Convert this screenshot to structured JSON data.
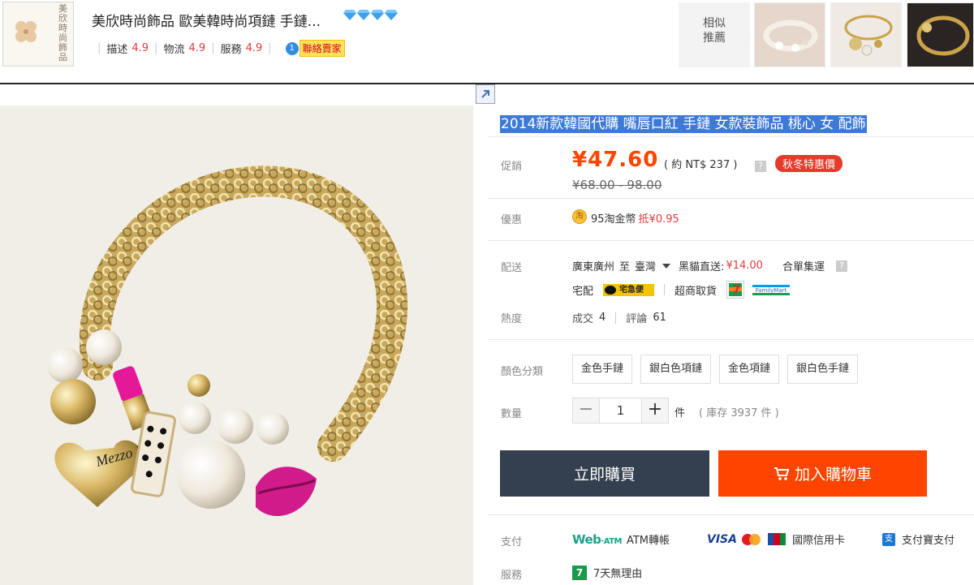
{
  "shop": {
    "logo_vertical_text": "美欣時尚飾品",
    "name": "美欣時尚飾品 歐美韓時尚項鏈 手鏈...",
    "ratings": [
      {
        "label": "描述",
        "value": "4.9"
      },
      {
        "label": "物流",
        "value": "4.9"
      },
      {
        "label": "服務",
        "value": "4.9"
      }
    ],
    "contact_label": "聯絡賣家",
    "diamond_count": 4
  },
  "similar": {
    "label_line1": "相似",
    "label_line2": "推薦"
  },
  "product": {
    "title": "2014新款韓國代購 嘴唇口紅 手鏈 女款裝飾品 桃心 女 配飾",
    "image_alt_text": "Mezzo Piano"
  },
  "price": {
    "label": "促銷",
    "current": "¥47.60",
    "ntd": "( 約 NT$ 237 )",
    "help": "?",
    "badge": "秋冬特惠價",
    "original": "¥68.00 - 98.00"
  },
  "discount": {
    "label": "優惠",
    "coin_icon": "淘",
    "text": "95淘金幣",
    "deduct": "抵¥0.95"
  },
  "shipping": {
    "label": "配送",
    "from": "廣東廣州",
    "to_word": "至",
    "destination": "臺灣",
    "direct_label": "黑貓直送:",
    "direct_fee": "¥14.00",
    "consolidate": "合單集運",
    "help": "?",
    "home_delivery": "宅配",
    "black_cat_text": "宅急便",
    "store_pickup": "超商取貨",
    "familymart_text": "FamilyMart"
  },
  "heat": {
    "label": "熱度",
    "sold_label": "成交",
    "sold": "4",
    "review_label": "評論",
    "reviews": "61"
  },
  "colors": {
    "label": "顏色分類",
    "options": [
      "金色手鏈",
      "銀白色項鏈",
      "金色項鏈",
      "銀白色手鏈"
    ]
  },
  "quantity": {
    "label": "數量",
    "minus": "−",
    "value": "1",
    "plus": "+",
    "unit": "件",
    "stock": "( 庫存 3937 件 )"
  },
  "actions": {
    "buy_now": "立即購買",
    "add_to_cart": "加入購物車"
  },
  "payment": {
    "label": "支付",
    "webatm_main": "Web",
    "webatm_small": "·ATM",
    "atm": "ATM轉帳",
    "visa": "VISA",
    "intl_card": "國際信用卡",
    "alipay_icon": "支",
    "alipay": "支付寶支付"
  },
  "service": {
    "label": "服務",
    "icon": "7",
    "text": "7天無理由"
  },
  "colors_theme": {
    "accent": "#ff4400",
    "buy_button": "#34404f",
    "title_highlight": "#3d7ad6"
  }
}
